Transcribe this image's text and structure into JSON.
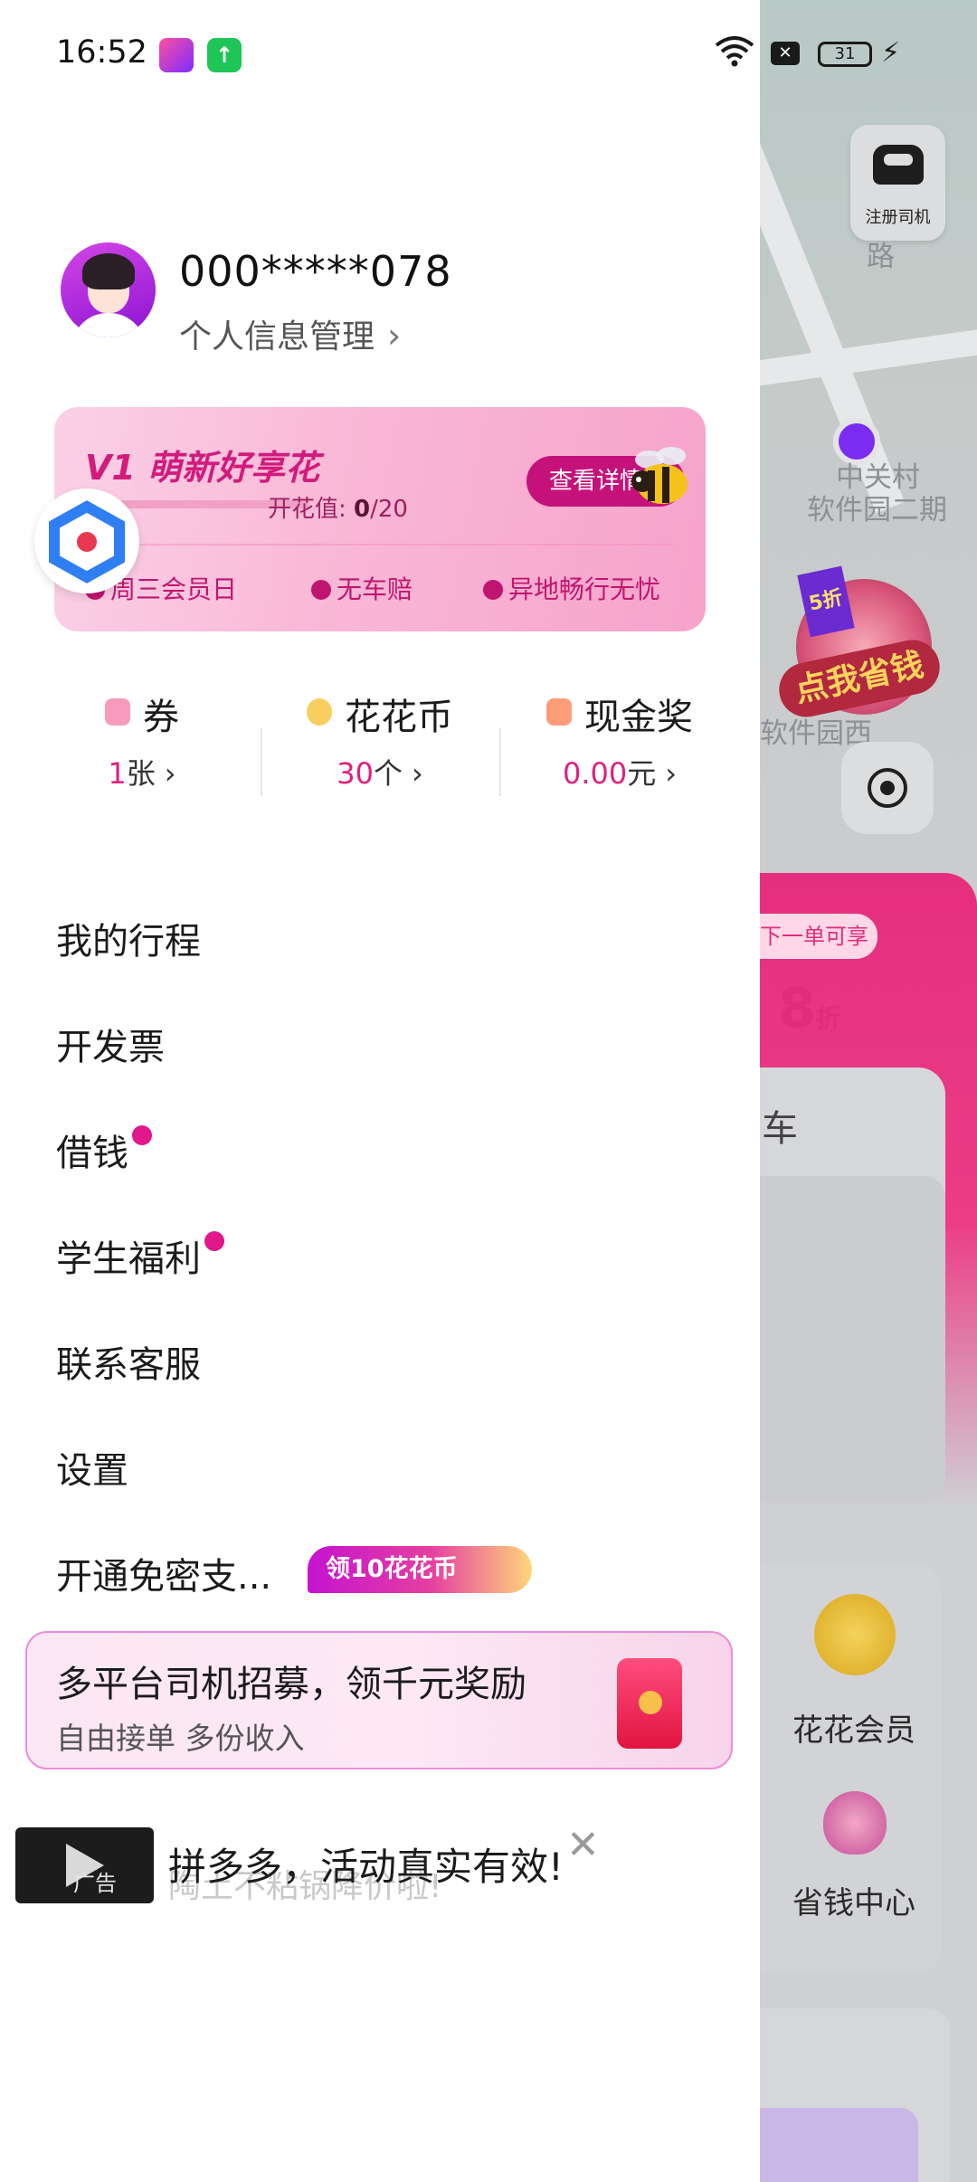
{
  "status_bar": {
    "time": "16:52",
    "battery": "31",
    "icons": [
      "app-icon-1",
      "app-icon-2",
      "wifi-icon",
      "x-icon",
      "battery-icon",
      "charging-icon"
    ]
  },
  "profile": {
    "phone": "000*****078",
    "manage_link": "个人信息管理"
  },
  "vip_card": {
    "title": "V1 萌新好享花",
    "progress_label": "开花值:",
    "progress_value": "0",
    "progress_total": "/20",
    "detail_button": "查看详情",
    "perks": [
      "周三会员日",
      "无车赔",
      "异地畅行无忧"
    ]
  },
  "assets": [
    {
      "label": "券",
      "value": "1",
      "unit": "张",
      "color": "#f36c9a"
    },
    {
      "label": "花花币",
      "value": "30",
      "unit": "个",
      "color": "#f7c35a"
    },
    {
      "label": "现金奖",
      "value": "0.00",
      "unit": "元",
      "color": "#ff8a5c"
    }
  ],
  "menu": {
    "items": [
      "我的行程",
      "开发票",
      "借钱",
      "学生福利",
      "联系客服",
      "设置",
      "开通免密支..."
    ],
    "promo_tag": "领10花花币"
  },
  "recruit_banner": {
    "title": "多平台司机招募，领千元奖励",
    "subtitle": "自由接单 多份收入"
  },
  "ad": {
    "label": "广告",
    "title": "拼多多，活动真实有效!",
    "subtitle": "陶土不粘锅降价啦!"
  },
  "background": {
    "register_driver": "注册司机",
    "road_label": "路",
    "place_label_1": "中关村",
    "place_label_2": "软件园二期",
    "place_label_3": "软件园西",
    "promo_label": "点我省钱",
    "promo_discount": "5折",
    "next_order_label": "下一单可享",
    "discount_num": "8",
    "discount_unit": "折",
    "car_label": "车",
    "huahua_member": "花花会员",
    "saving_center": "省钱中心"
  }
}
